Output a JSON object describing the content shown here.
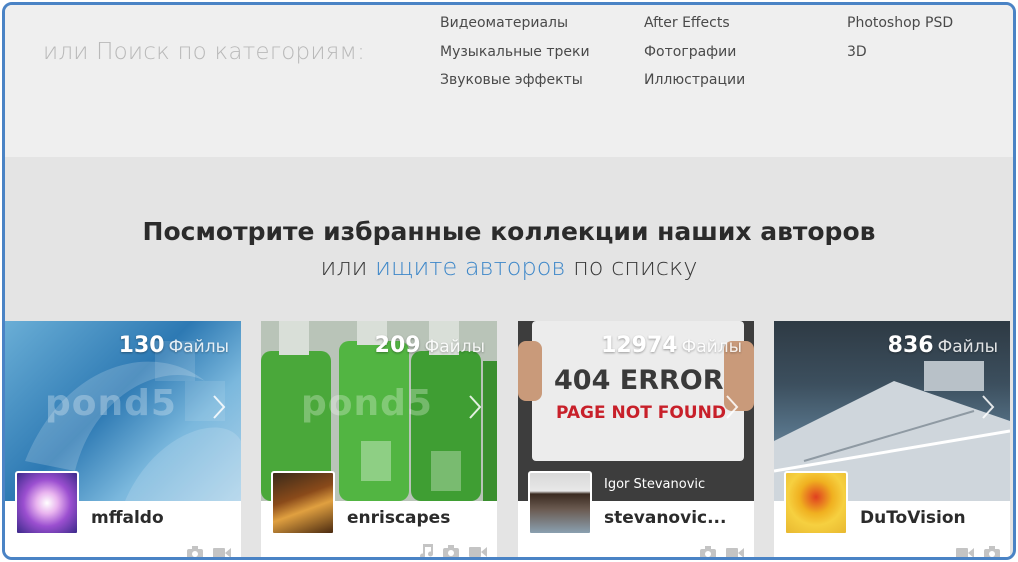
{
  "categories": {
    "title": "или Поиск по категориям:",
    "col1": [
      "Видеоматериалы",
      "Музыкальные треки",
      "Звуковые эффекты"
    ],
    "col2": [
      "After Effects",
      "Фотографии",
      "Иллюстрации"
    ],
    "col3": [
      "Photoshop PSD",
      "3D"
    ]
  },
  "featured": {
    "heading": "Посмотрите избранные коллекции наших авторов",
    "sub_prefix": "или",
    "sub_link": "ищите авторов",
    "sub_suffix": "по списку"
  },
  "files_unit": "Файлы",
  "watermark": "pond5",
  "cards": [
    {
      "count": "130",
      "username": "mffaldo",
      "fullname": "",
      "icons": [
        "camera-icon",
        "video-icon"
      ]
    },
    {
      "count": "209",
      "username": "enriscapes",
      "fullname": "",
      "icons": [
        "music-note-icon",
        "camera-icon",
        "video-icon"
      ]
    },
    {
      "count": "12974",
      "username": "stevanovic...",
      "fullname": "Igor Stevanovic",
      "icons": [
        "camera-icon",
        "video-icon"
      ]
    },
    {
      "count": "836",
      "username": "DuToVision",
      "fullname": "",
      "icons": [
        "video-icon",
        "camera-icon"
      ]
    }
  ],
  "thumb_texts": {
    "error_line1": "404 ERROR",
    "error_line2": "PAGE NOT FOUND"
  },
  "colors": {
    "frame": "#4a83c5",
    "link": "#3f88c9",
    "error_red": "#c8202a"
  }
}
